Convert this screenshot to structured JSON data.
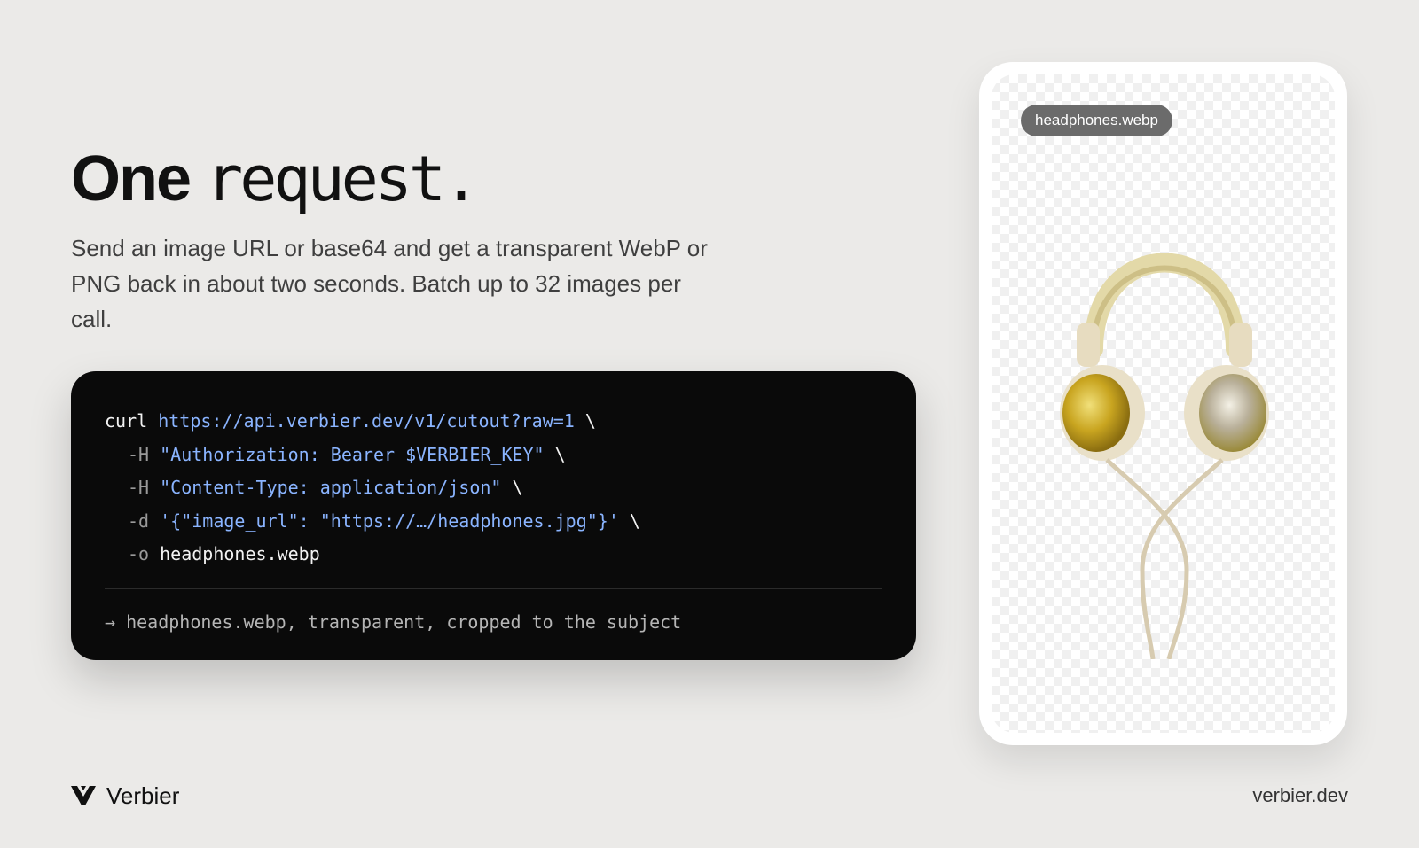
{
  "hero": {
    "title_bold": "One",
    "title_light": "request.",
    "description": "Send an image URL or base64 and get a transparent WebP or PNG back in about two seconds. Batch up to 32 images per call."
  },
  "code": {
    "lines": [
      [
        {
          "t": "curl ",
          "k": "plain"
        },
        {
          "t": "https://api.verbier.dev/v1/cutout?raw=1",
          "k": "str"
        },
        {
          "t": " \\",
          "k": "plain"
        }
      ],
      [
        {
          "t": "-H ",
          "k": "flag"
        },
        {
          "t": "\"Authorization: Bearer $VERBIER_KEY\"",
          "k": "str"
        },
        {
          "t": " \\",
          "k": "plain"
        }
      ],
      [
        {
          "t": "-H ",
          "k": "flag"
        },
        {
          "t": "\"Content-Type: application/json\"",
          "k": "str"
        },
        {
          "t": " \\",
          "k": "plain"
        }
      ],
      [
        {
          "t": "-d ",
          "k": "flag"
        },
        {
          "t": "'{\"image_url\": \"https://…/headphones.jpg\"}'",
          "k": "str"
        },
        {
          "t": " \\",
          "k": "plain"
        }
      ],
      [
        {
          "t": "-o ",
          "k": "flag"
        },
        {
          "t": "headphones.webp",
          "k": "plain"
        }
      ]
    ],
    "result": "→ headphones.webp, transparent, cropped to the subject"
  },
  "preview": {
    "filename": "headphones.webp",
    "image": "headphones-product-cutout"
  },
  "footer": {
    "brand_name": "Verbier",
    "logo_icon": "verbier-v-logo",
    "url": "verbier.dev"
  },
  "colors": {
    "background": "#ebeae8",
    "code_bg": "#0a0a0a",
    "code_string": "#8ab4ff",
    "code_flag": "#9a9a9a",
    "pill_bg": "#6b6b6b"
  }
}
